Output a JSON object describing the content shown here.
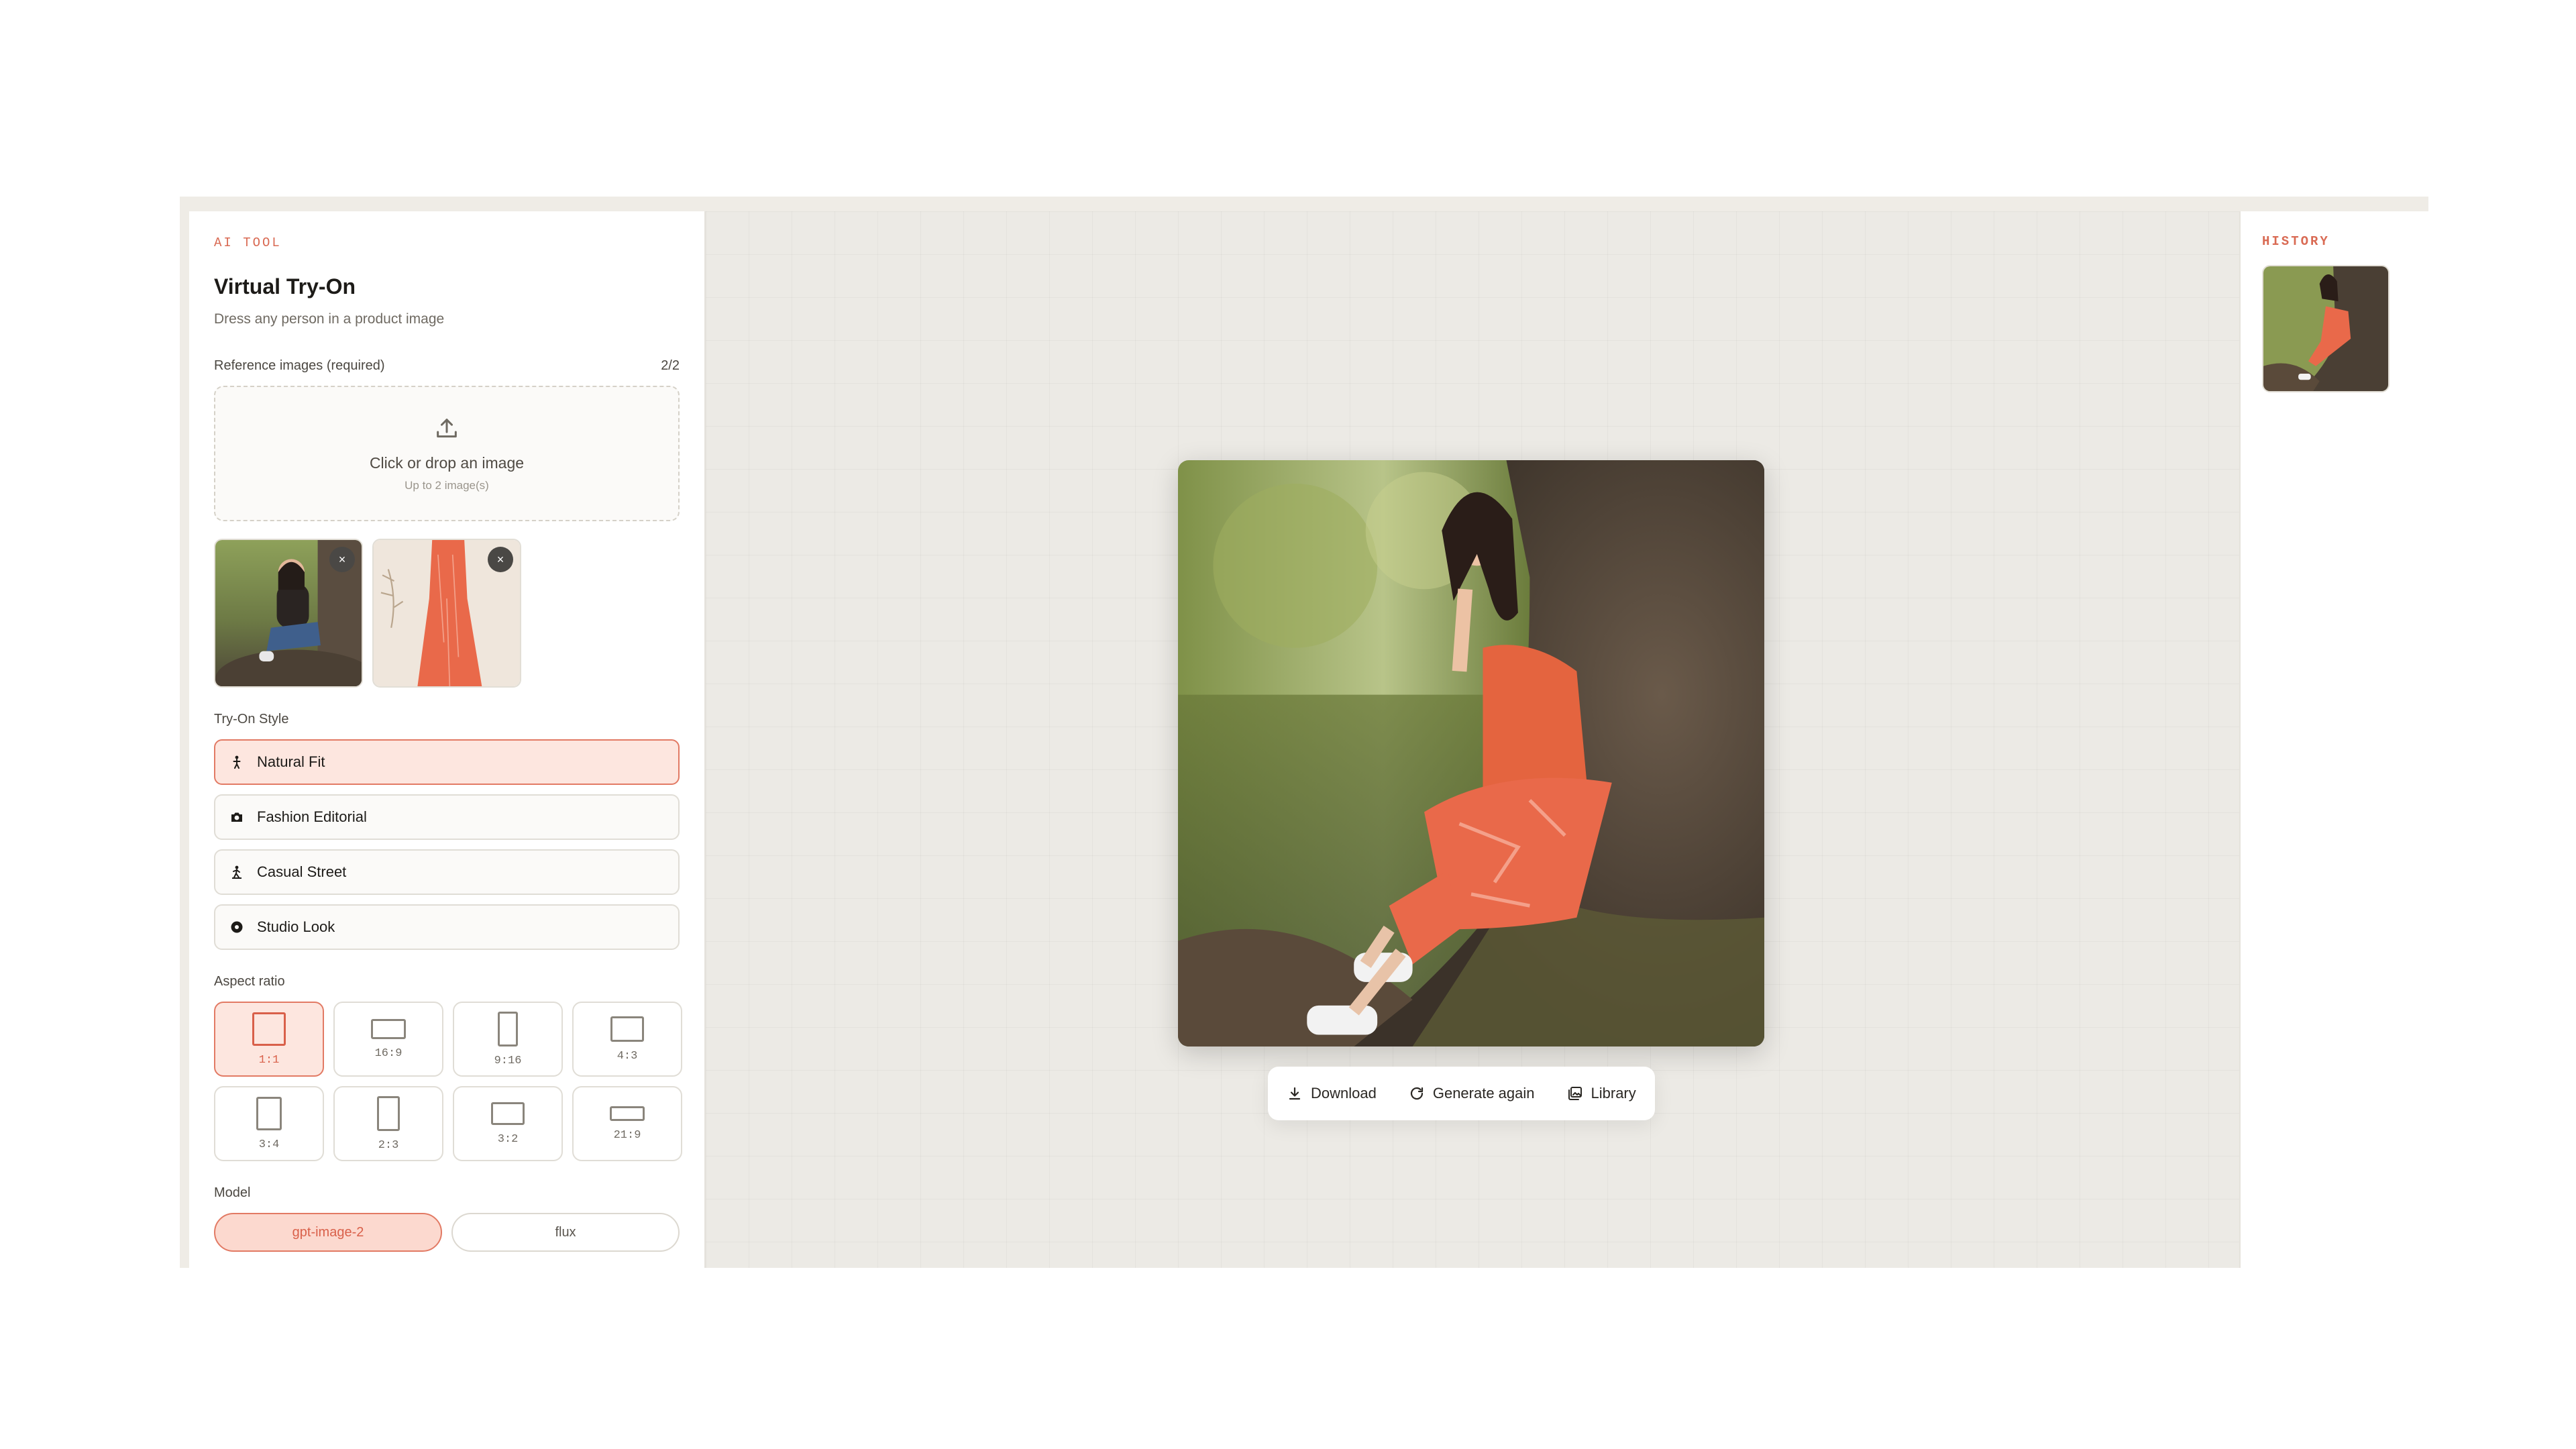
{
  "app": {
    "eyebrow": "AI TOOL",
    "title": "Virtual Try-On",
    "subtitle": "Dress any person in a product image"
  },
  "reference": {
    "label": "Reference images (required)",
    "count": "2/2",
    "upload_main": "Click or drop an image",
    "upload_sub": "Up to 2 image(s)",
    "remove_glyph": "×"
  },
  "styles": {
    "label": "Try-On Style",
    "items": [
      {
        "label": "Natural Fit",
        "icon": "person-icon",
        "active": true
      },
      {
        "label": "Fashion Editorial",
        "icon": "camera-icon",
        "active": false
      },
      {
        "label": "Casual Street",
        "icon": "walking-icon",
        "active": false
      },
      {
        "label": "Studio Look",
        "icon": "record-icon",
        "active": false
      }
    ]
  },
  "aspect": {
    "label": "Aspect ratio",
    "options": [
      "1:1",
      "16:9",
      "9:16",
      "4:3",
      "3:4",
      "2:3",
      "3:2",
      "21:9"
    ],
    "selected": "1:1"
  },
  "model": {
    "label": "Model",
    "options": [
      "gpt-image-2",
      "flux"
    ],
    "selected": "gpt-image-2"
  },
  "toolbar": {
    "download": "Download",
    "generate_again": "Generate again",
    "library": "Library"
  },
  "history": {
    "label": "HISTORY"
  },
  "colors": {
    "accent": "#d96a53",
    "accent_bg": "#fde6df",
    "canvas_bg": "#eceae5"
  }
}
